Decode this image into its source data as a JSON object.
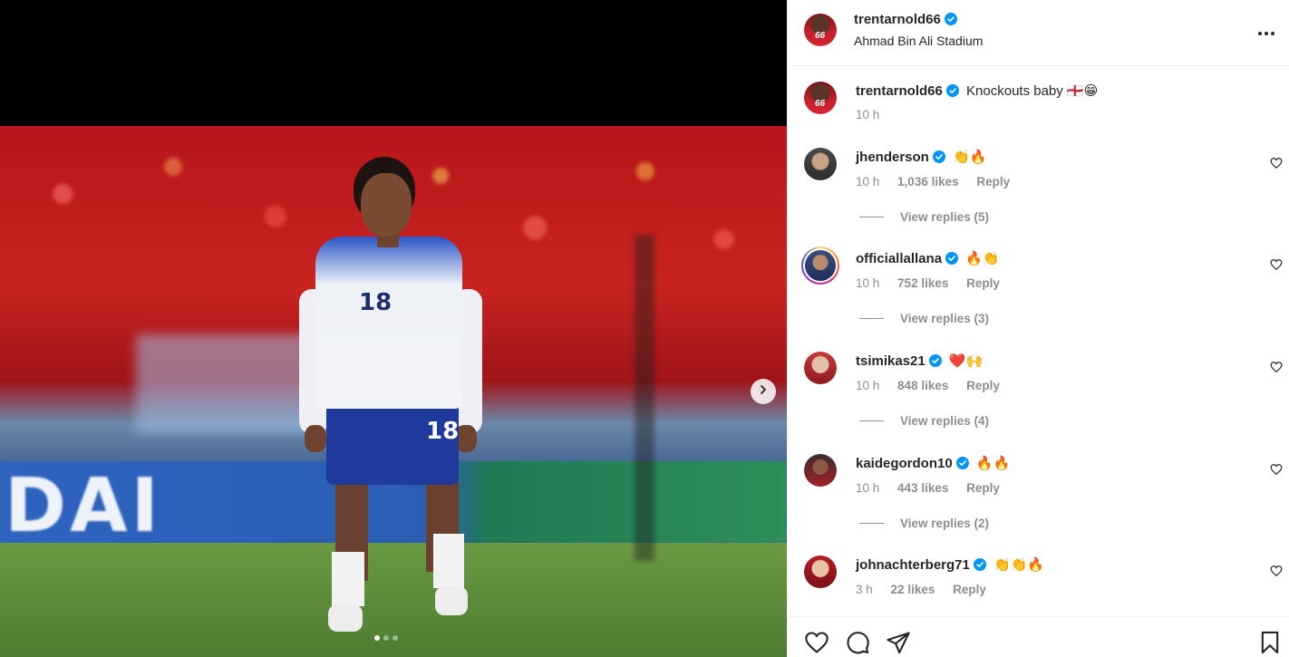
{
  "post": {
    "author": "trentarnold66",
    "location": "Ahmad Bin Ali Stadium",
    "verified": true,
    "avatar_jersey_number": "66"
  },
  "media": {
    "image_count": 3,
    "current_index": 1,
    "next_icon": "chevron-right-icon",
    "photo_text": {
      "jersey_number": "18",
      "banner": "DAI"
    }
  },
  "caption": {
    "username": "trentarnold66",
    "text": "Knockouts baby 🏴󠁧󠁢󠁥󠁮󠁧󠁿😁",
    "time": "10 h"
  },
  "comments": [
    {
      "username": "jhenderson",
      "text": "👏🔥",
      "time": "10 h",
      "likes": "1,036 likes",
      "reply": "Reply",
      "view_replies": "View replies (5)"
    },
    {
      "username": "officiallallana",
      "text": "🔥👏",
      "time": "10 h",
      "likes": "752 likes",
      "reply": "Reply",
      "view_replies": "View replies (3)"
    },
    {
      "username": "tsimikas21",
      "text": "❤️🙌",
      "time": "10 h",
      "likes": "848 likes",
      "reply": "Reply",
      "view_replies": "View replies (4)"
    },
    {
      "username": "kaidegordon10",
      "text": "🔥🔥",
      "time": "10 h",
      "likes": "443 likes",
      "reply": "Reply",
      "view_replies": "View replies (2)"
    },
    {
      "username": "johnachterberg71",
      "text": "👏👏🔥",
      "time": "3 h",
      "likes": "22 likes",
      "reply": "Reply",
      "view_replies": ""
    }
  ],
  "actions": {
    "icons": [
      "heart-icon",
      "comment-icon",
      "share-icon",
      "bookmark-icon"
    ]
  },
  "colors": {
    "verified": "#0095f6",
    "text": "#262626",
    "secondary": "#8e8e8e",
    "divider": "#efefef"
  }
}
